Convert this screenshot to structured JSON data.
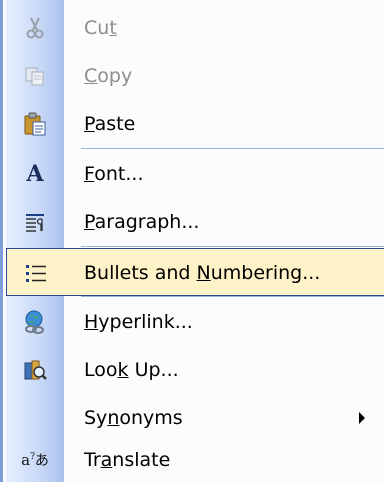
{
  "menu": {
    "items": [
      {
        "name": "cut",
        "icon": "scissors-icon",
        "pre": "Cu",
        "key": "t",
        "post": "",
        "disabled": true
      },
      {
        "name": "copy",
        "icon": "copy-icon",
        "pre": "",
        "key": "C",
        "post": "opy",
        "disabled": true
      },
      {
        "name": "paste",
        "icon": "paste-icon",
        "pre": "",
        "key": "P",
        "post": "aste",
        "disabled": false
      },
      {
        "name": "font",
        "icon": "font-icon",
        "pre": "",
        "key": "F",
        "post": "ont...",
        "glyph": "A",
        "disabled": false
      },
      {
        "name": "paragraph",
        "icon": "paragraph-icon",
        "pre": "",
        "key": "P",
        "post": "aragraph...",
        "disabled": false
      },
      {
        "name": "bullets-and-numbering",
        "icon": "bullets-icon",
        "pre": "Bullets and ",
        "key": "N",
        "post": "umbering...",
        "highlighted": true,
        "disabled": false
      },
      {
        "name": "hyperlink",
        "icon": "hyperlink-icon",
        "pre": "",
        "key": "H",
        "post": "yperlink...",
        "disabled": false
      },
      {
        "name": "look-up",
        "icon": "research-icon",
        "pre": "Loo",
        "key": "k",
        "post": " Up...",
        "disabled": false
      },
      {
        "name": "synonyms",
        "icon": "",
        "pre": "Sy",
        "key": "n",
        "post": "onyms",
        "submenu": true,
        "disabled": false
      },
      {
        "name": "translate",
        "icon": "translate-icon",
        "pre": "Tr",
        "key": "a",
        "post": "nslate",
        "glyph": "a",
        "disabled": false
      }
    ]
  },
  "colors": {
    "highlight_bg": "#fdf2c8",
    "highlight_border": "#2b4c8f",
    "separator": "#9eb4dc",
    "disabled_text": "#8d8d8d"
  }
}
